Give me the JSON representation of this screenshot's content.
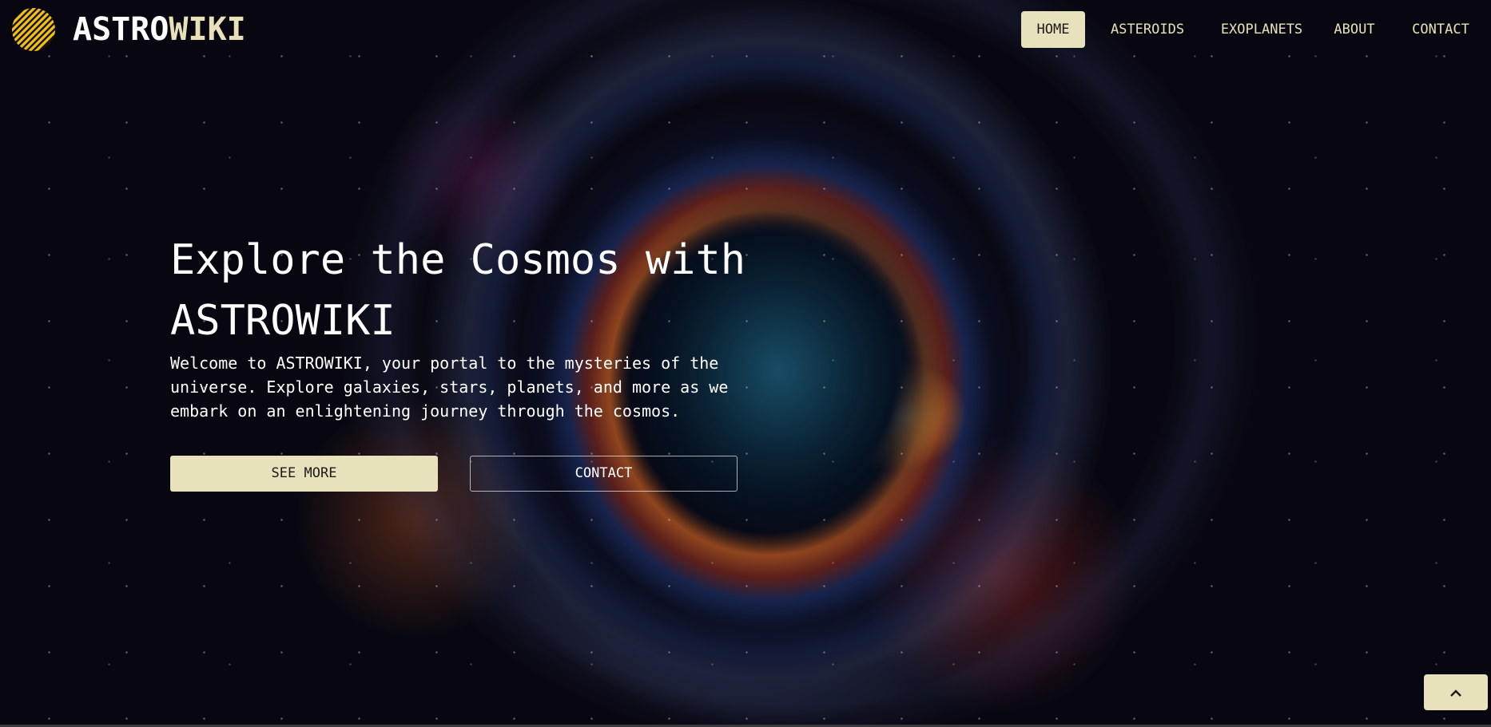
{
  "brand": {
    "name_part1": "ASTRO",
    "name_part2": "WIKI",
    "logo_icon": "striped-moon-icon",
    "accent_color": "#e8e2bc",
    "logo_color": "#f2c21a"
  },
  "nav": {
    "items": [
      {
        "label": "HOME",
        "active": true
      },
      {
        "label": "ASTEROIDS",
        "active": false
      },
      {
        "label": "EXOPLANETS",
        "active": false
      },
      {
        "label": "ABOUT",
        "active": false
      },
      {
        "label": "CONTACT",
        "active": false
      }
    ]
  },
  "hero": {
    "title": "Explore the Cosmos with ASTROWIKI",
    "description": "Welcome to ASTROWIKI, your portal to the mysteries of the universe. Explore galaxies, stars, planets, and more as we embark on an enlightening journey through the cosmos.",
    "primary_button": "SEE MORE",
    "secondary_button": "CONTACT"
  },
  "scroll_top": {
    "icon": "chevron-up-icon"
  }
}
